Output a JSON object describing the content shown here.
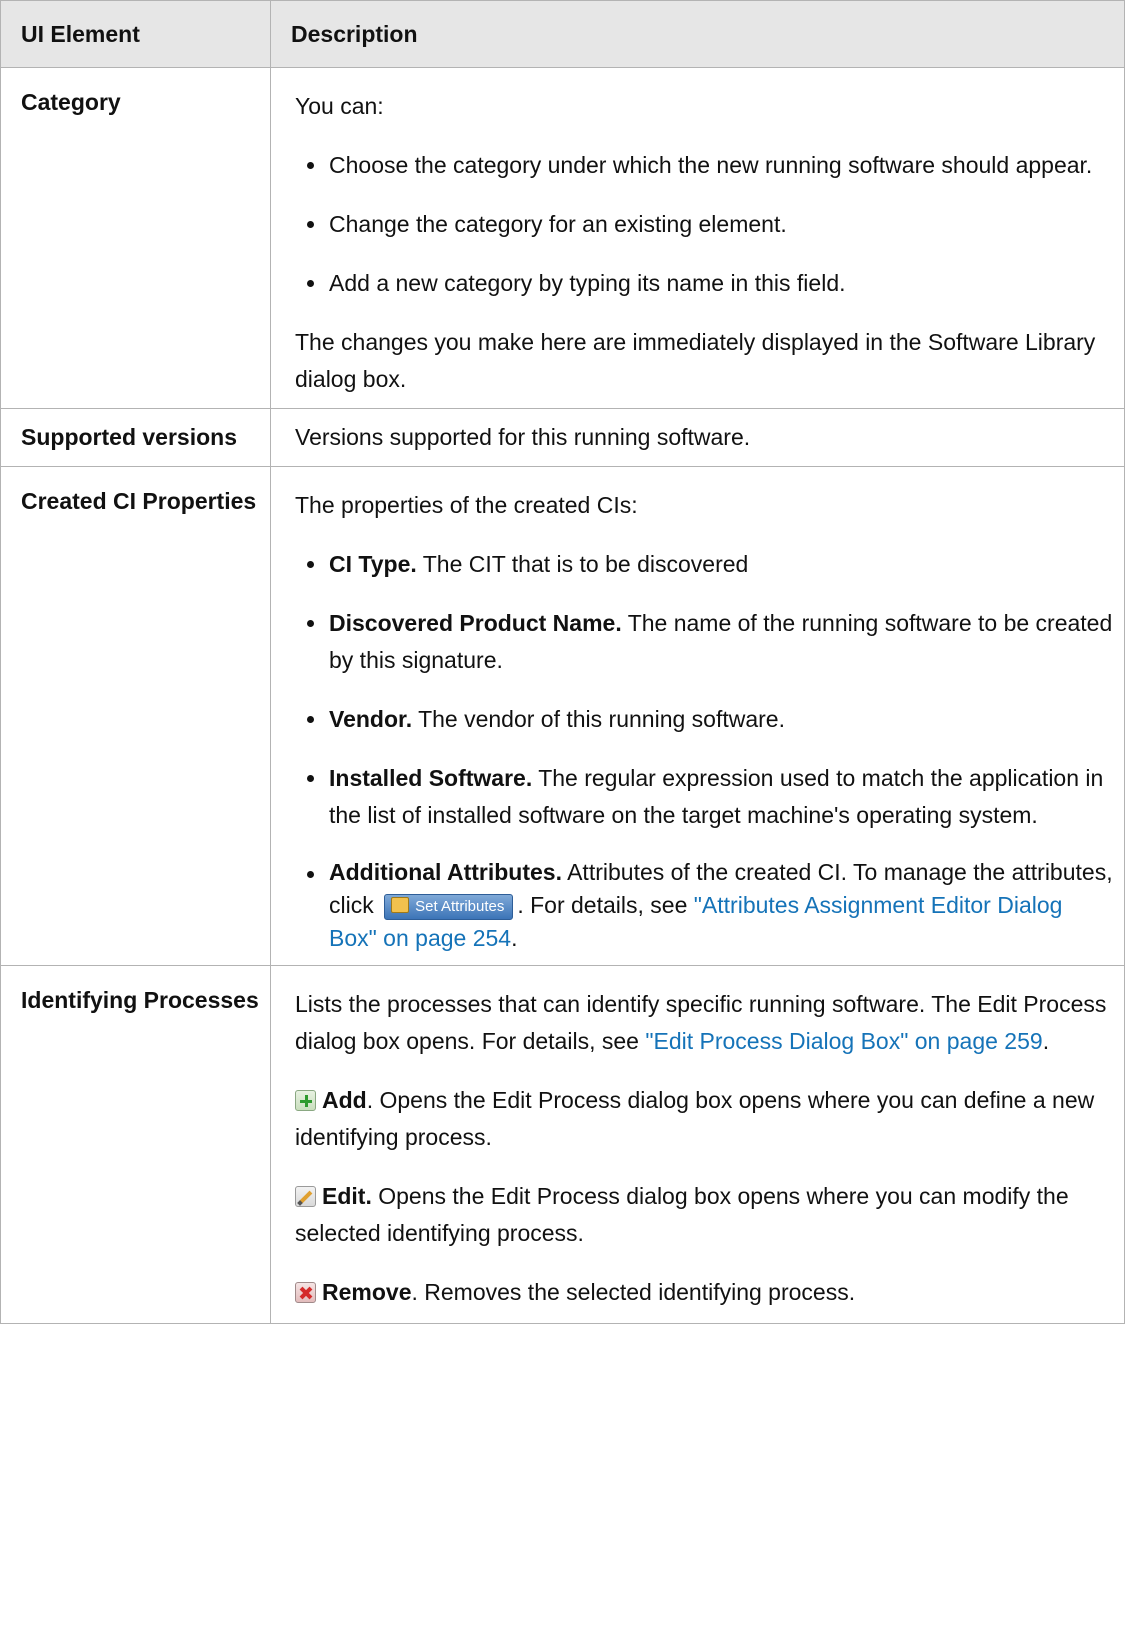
{
  "headers": {
    "element": "UI Element",
    "description": "Description"
  },
  "rows": {
    "category": {
      "name": "Category",
      "intro": "You can:",
      "bullets": [
        "Choose the category under which the new running software should appear.",
        "Change the category for an existing element.",
        "Add a new category by typing its name in this field."
      ],
      "note": "The changes you make here are immediately displayed in the Software Library dialog box."
    },
    "versions": {
      "name": "Supported versions",
      "text": "Versions supported for this running software."
    },
    "created": {
      "name": "Created CI Properties",
      "intro": "The properties of the created CIs:",
      "items": [
        {
          "term": "CI Type.",
          "text": " The CIT that is to be discovered"
        },
        {
          "term": "Discovered Product Name.",
          "text": " The name of the running software to be created by this signature."
        },
        {
          "term": "Vendor.",
          "text": " The vendor of this running software."
        },
        {
          "term": "Installed Software.",
          "text": " The regular expression used to match the application in the list of installed software on the target machine's operating system."
        }
      ],
      "additional": {
        "term": "Additional Attributes.",
        "text1": " Attributes of the created CI. To manage the attributes, click ",
        "button_label": "Set Attributes",
        "text2": ". For details, see ",
        "link": "\"Attributes Assignment Editor Dialog Box\" on page 254",
        "text3": "."
      }
    },
    "processes": {
      "name": "Identifying Processes",
      "intro": "Lists the processes that can identify specific running software. The Edit Process dialog box opens. For details, see ",
      "link": "\"Edit Process Dialog Box\" on page 259",
      "intro_end": ".",
      "add": {
        "icon": "add-icon",
        "term": "Add",
        "text": ". Opens the Edit Process dialog box opens where you can define a new identifying process."
      },
      "edit": {
        "icon": "edit-icon",
        "term": "Edit.",
        "text": " Opens the Edit Process dialog box opens where you can modify the selected identifying process."
      },
      "remove": {
        "icon": "remove-icon",
        "term": "Remove",
        "text": ". Removes the selected identifying process."
      }
    }
  }
}
